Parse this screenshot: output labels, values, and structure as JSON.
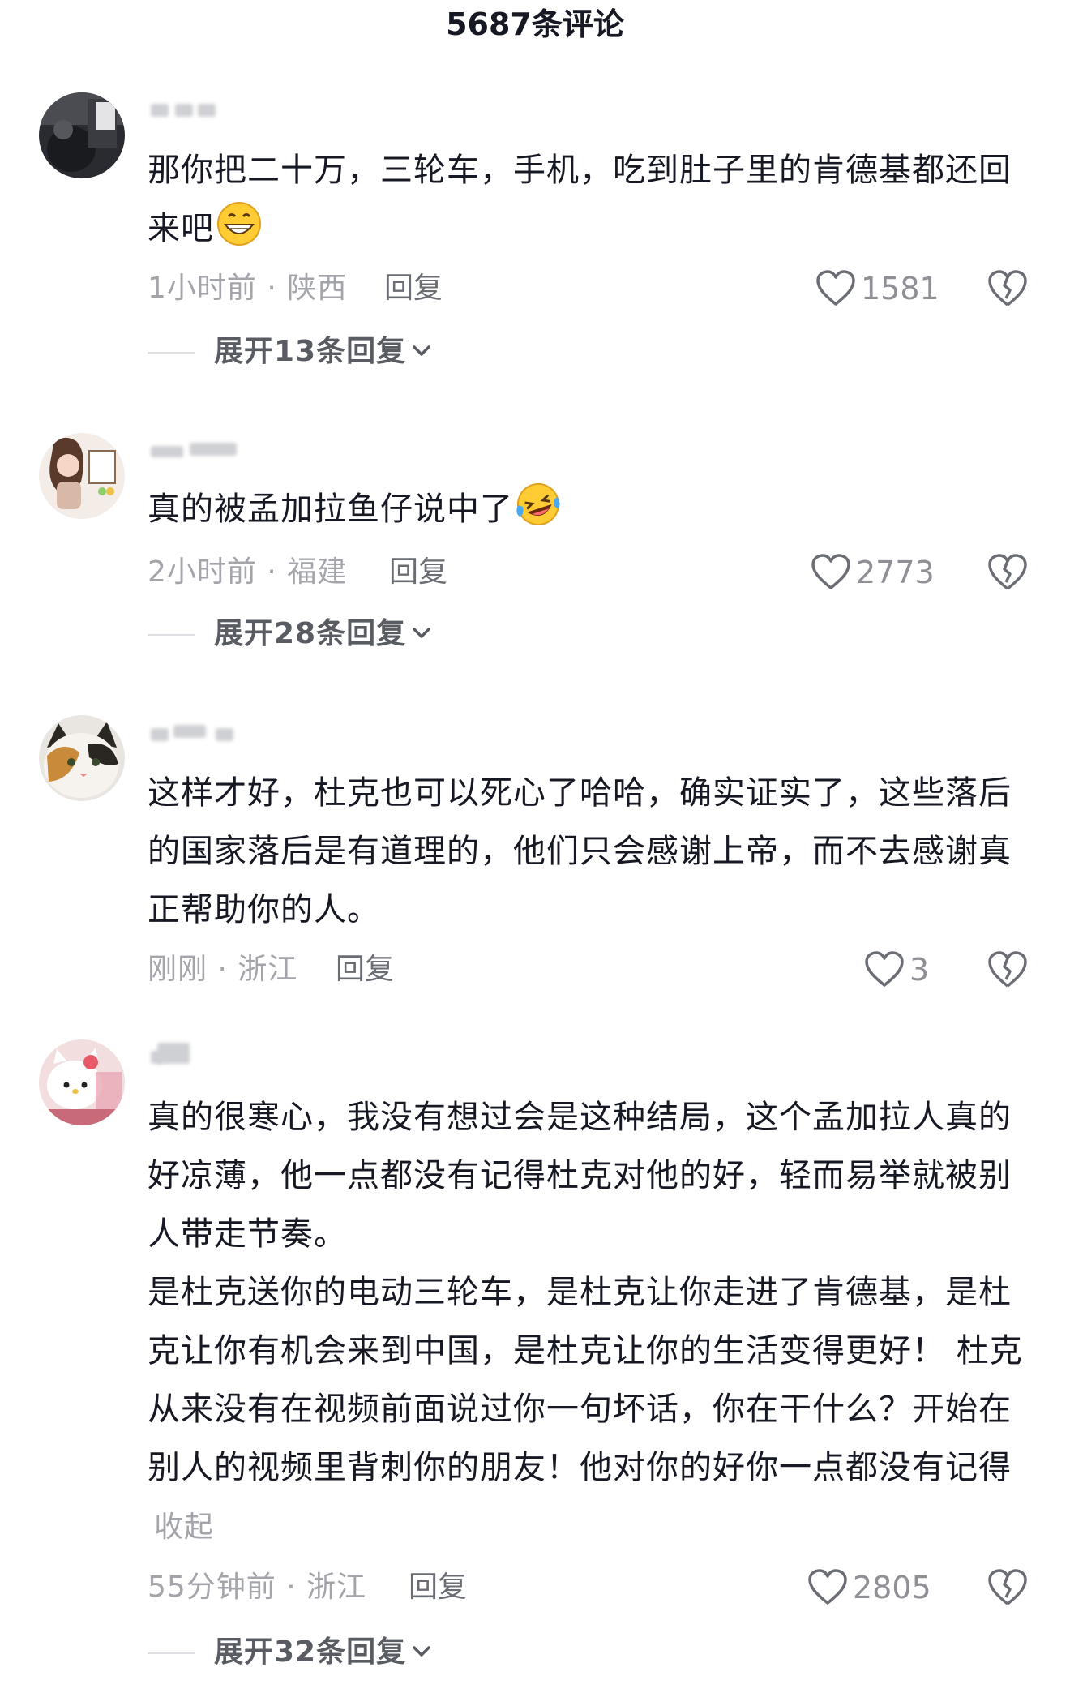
{
  "header": {
    "title": "5687条评论"
  },
  "comments": [
    {
      "text": "那你把二十万，三轮车，手机，吃到肚子里的肯德基都还回来吧",
      "emoji": "grinning-face-emoji",
      "time_location": "1小时前 · 陕西",
      "reply_label": "回复",
      "likes": "1581",
      "expand_label": "展开13条回复"
    },
    {
      "text": "真的被孟加拉鱼仔说中了",
      "emoji": "laughing-crying-face-emoji",
      "time_location": "2小时前 · 福建",
      "reply_label": "回复",
      "likes": "2773",
      "expand_label": "展开28条回复"
    },
    {
      "text": "这样才好，杜克也可以死心了哈哈，确实证实了，这些落后的国家落后是有道理的，他们只会感谢上帝，而不去感谢真正帮助你的人。",
      "time_location": "刚刚 · 浙江",
      "reply_label": "回复",
      "likes": "3"
    },
    {
      "text": "真的很寒心，我没有想过会是这种结局，这个孟加拉人真的好凉薄，他一点都没有记得杜克对他的好，轻而易举就被别人带走节奏。",
      "text_2": "是杜克送你的电动三轮车，是杜克让你走进了肯德基，是杜克让你有机会来到中国，是杜克让你的生活变得更好！ 杜克从来没有在视频前面说过你一句坏话，你在干什么？开始在别人的视频里背刺你的朋友！他对你的好你一点都没有记得",
      "collapse_label": "收起",
      "time_location": "55分钟前 · 浙江",
      "reply_label": "回复",
      "likes": "2805",
      "expand_label": "展开32条回复"
    }
  ],
  "colors": {
    "primary_text": "#161823",
    "secondary_text": "#a3a5ab",
    "reply_text": "#6b6d75",
    "background": "#ffffff"
  }
}
